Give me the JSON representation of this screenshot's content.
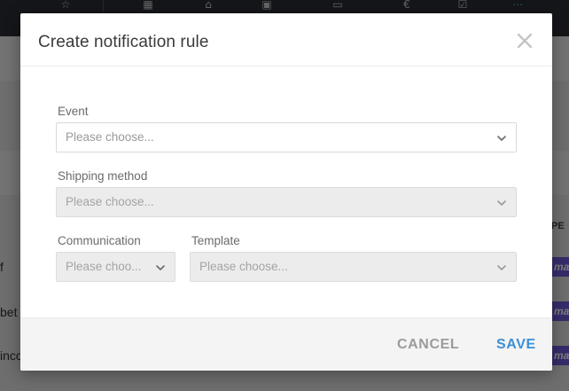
{
  "modal": {
    "title": "Create notification rule",
    "fields": {
      "event": {
        "label": "Event",
        "placeholder": "Please choose..."
      },
      "shipping_method": {
        "label": "Shipping method",
        "placeholder": "Please choose..."
      },
      "communication": {
        "label": "Communication",
        "placeholder": "Please choo..."
      },
      "template": {
        "label": "Template",
        "placeholder": "Please choose..."
      }
    },
    "footer": {
      "cancel_label": "CANCEL",
      "save_label": "SAVE"
    }
  },
  "background": {
    "column_header": "PE",
    "row_texts": [
      "f",
      "bet",
      "inco"
    ],
    "pill_text": "ma",
    "topbar_icons": [
      "star-icon",
      "grid-icon",
      "tag-icon",
      "box-icon",
      "window-icon",
      "euro-icon",
      "checklist-icon",
      "more-icon"
    ]
  },
  "colors": {
    "accent": "#3b8fd9",
    "topbar": "#2a2d32",
    "pill": "#6a5ad6",
    "cancel": "#9b9b9b"
  }
}
